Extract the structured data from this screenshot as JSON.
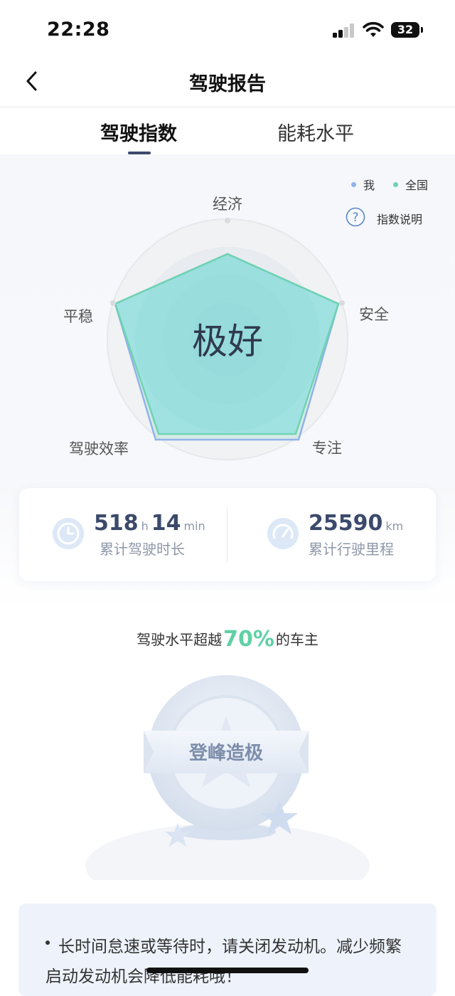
{
  "status": {
    "time": "22:28",
    "battery": "32"
  },
  "nav": {
    "title": "驾驶报告",
    "back_icon": "chevron-left-icon"
  },
  "tabs": [
    {
      "label": "驾驶指数",
      "active": true
    },
    {
      "label": "能耗水平",
      "active": false
    }
  ],
  "legend": [
    {
      "label": "我",
      "color": "#8fb3e8"
    },
    {
      "label": "全国",
      "color": "#6fd3b1"
    }
  ],
  "help": {
    "label": "指数说明",
    "icon": "question-circle-icon"
  },
  "radar": {
    "center_label": "极好",
    "axes": [
      "经济",
      "安全",
      "专注",
      "驾驶效率",
      "平稳"
    ]
  },
  "stats": {
    "duration": {
      "hours": "518",
      "hours_unit": "h",
      "minutes": "14",
      "minutes_unit": "min",
      "label": "累计驾驶时长",
      "icon": "clock-icon"
    },
    "mileage": {
      "value": "25590",
      "unit": "km",
      "label": "累计行驶里程",
      "icon": "speedometer-icon"
    }
  },
  "exceed": {
    "prefix": "驾驶水平超越",
    "percent": "70%",
    "suffix": "的车主"
  },
  "badge": {
    "title": "登峰造极"
  },
  "tips": {
    "text": "长时间怠速或等待时，请关闭发动机。减少频繁启动发动机会降低能耗哦！"
  }
}
